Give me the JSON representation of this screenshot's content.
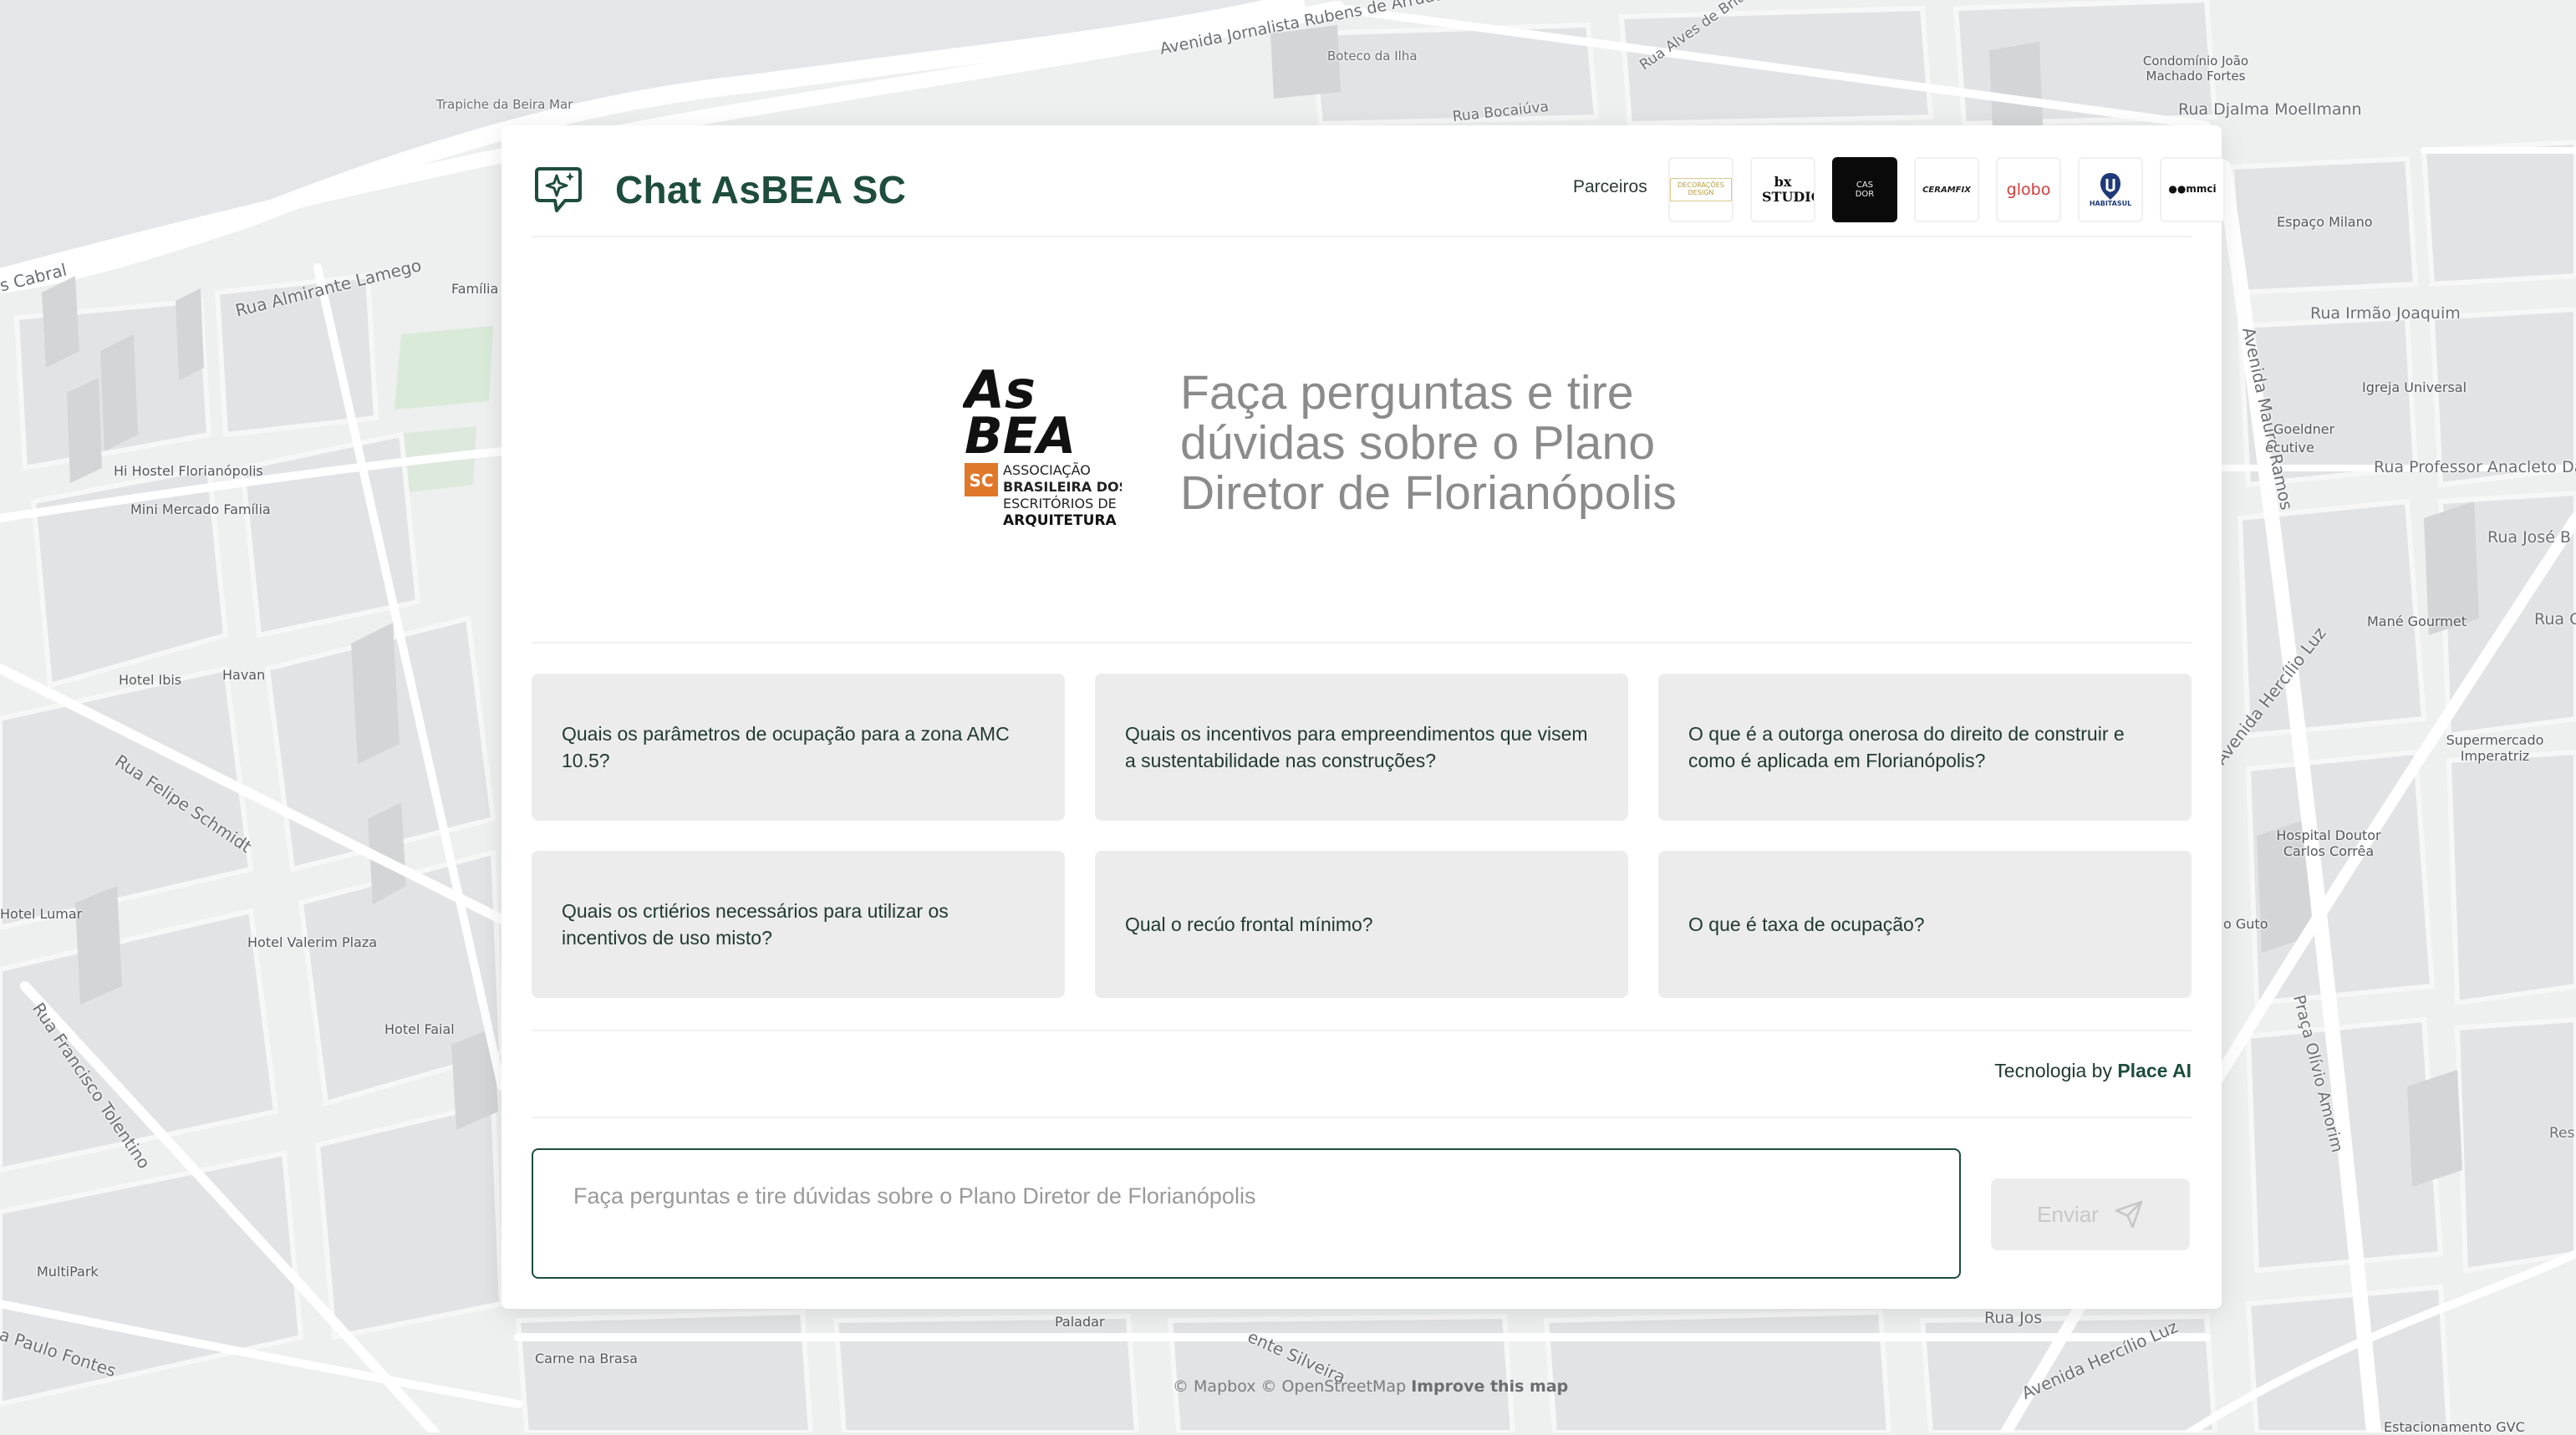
{
  "app": {
    "title": "Chat AsBEA SC",
    "partners_label": "Parceiros",
    "partners": [
      {
        "name": "Decorações Design",
        "short": "DECORAÇÕES DESIGN"
      },
      {
        "name": "bx studio",
        "short": "bx STUDIO"
      },
      {
        "name": "Casa Cor",
        "short": "CAS\nDOR"
      },
      {
        "name": "Ceramfix",
        "short": "CERAMFIX"
      },
      {
        "name": "globo",
        "short": "globo"
      },
      {
        "name": "Habitasul",
        "short": "HABITASUL"
      },
      {
        "name": "mmci",
        "short": "●●mmci"
      }
    ],
    "colors": {
      "brand": "#1e4d3d",
      "accent": "#e0782a"
    }
  },
  "hero": {
    "logo_lines": [
      "As",
      "BEA",
      "SC",
      "ASSOCIAÇÃO",
      "BRASILEIRA DOS",
      "ESCRITÓRIOS DE",
      "ARQUITETURA"
    ],
    "headline": "Faça perguntas e tire dúvidas sobre o Plano Diretor de Florianópolis"
  },
  "suggestions": [
    "Quais os parâmetros de ocupação para a zona AMC 10.5?",
    "Quais os incentivos para empreendimentos que visem a sustentabilidade nas construções?",
    "O que é a outorga onerosa do direito de construir e como é aplicada em Florianópolis?",
    "Quais os crtiérios necessários para utilizar os incentivos de uso misto?",
    "Qual o recúo frontal mínimo?",
    "O que é taxa de ocupação?"
  ],
  "powered": {
    "prefix": "Tecnologia by",
    "brand": "Place AI"
  },
  "input": {
    "placeholder": "Faça perguntas e tire dúvidas sobre o Plano Diretor de Florianópolis",
    "value": "",
    "send_label": "Enviar",
    "send_icon": "paper-plane-icon"
  },
  "map": {
    "labels": [
      "Trapiche da Beira Mar",
      "Avenida Jornalista Rubens de Arruda Ramos",
      "Boteco da Ilha",
      "Condomínio João Machado Fortes",
      "Rua Djalma Moellmann",
      "Rua Bocaiúva",
      "Rua Alves de Brito",
      "s Cabral",
      "Rua Almirante Lamego",
      "Família",
      "Espaço Milano",
      "Rua Irmão Joaquim",
      "Avenida Mauro Ramos",
      "Igreja Universal",
      "Rua Professor Anacleto Da",
      "Rua José B",
      "Hi Hostel Florianópolis",
      "Mini Mercado Família",
      "Hotel Ibis",
      "Havan",
      "Rua Felipe Schmidt",
      "Mané Gourmet",
      "Rua Ga",
      "Avenida Hercílio Luz",
      "Supermercado Imperatriz",
      "Hotel Lumar",
      "Hotel Valerim Plaza",
      "Hospital Doutor Carlos Corrêa",
      "Hotel Faial",
      "Rua Francisco Tolentino",
      "o Guto",
      "Praça Olívio Amorim",
      "MultiPark",
      "a Paulo Fontes",
      "Carne na Brasa",
      "Paladar",
      "ente Silveira",
      "Rua Jos",
      "Avenida Hercílio Luz",
      "Estacionamento GVC",
      "Res",
      "Goeldner",
      "ecutive"
    ],
    "attribution_prefix": "© Mapbox © OpenStreetMap",
    "attribution_link": "Improve this map"
  }
}
